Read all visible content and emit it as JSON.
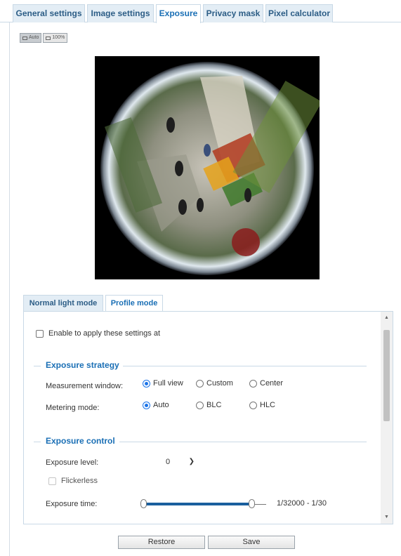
{
  "top_tabs": [
    {
      "label": "General settings",
      "active": false
    },
    {
      "label": "Image settings",
      "active": false
    },
    {
      "label": "Exposure",
      "active": true
    },
    {
      "label": "Privacy mask",
      "active": false
    },
    {
      "label": "Pixel calculator",
      "active": false
    }
  ],
  "view_buttons": [
    {
      "label": "Auto",
      "active": true
    },
    {
      "label": "100%",
      "active": false
    }
  ],
  "sub_tabs": [
    {
      "label": "Normal light mode",
      "active": false
    },
    {
      "label": "Profile mode",
      "active": true
    }
  ],
  "settings": {
    "enable_label": "Enable to apply these settings at",
    "exposure_strategy": {
      "title": "Exposure strategy",
      "measurement_window": {
        "label": "Measurement window:",
        "options": [
          "Full view",
          "Custom",
          "Center"
        ],
        "selected": "Full view"
      },
      "metering_mode": {
        "label": "Metering mode:",
        "options": [
          "Auto",
          "BLC",
          "HLC"
        ],
        "selected": "Auto"
      }
    },
    "exposure_control": {
      "title": "Exposure control",
      "exposure_level": {
        "label": "Exposure level:",
        "value": "0"
      },
      "flickerless_label": "Flickerless",
      "exposure_time": {
        "label": "Exposure time:",
        "range_text": "1/32000 - 1/30"
      }
    }
  },
  "buttons": {
    "restore": "Restore",
    "save": "Save"
  },
  "colors": {
    "accent": "#1a6fb5",
    "tab_bg": "#e3edf5",
    "border": "#c9d9e6",
    "slider": "#1a5f9e"
  }
}
